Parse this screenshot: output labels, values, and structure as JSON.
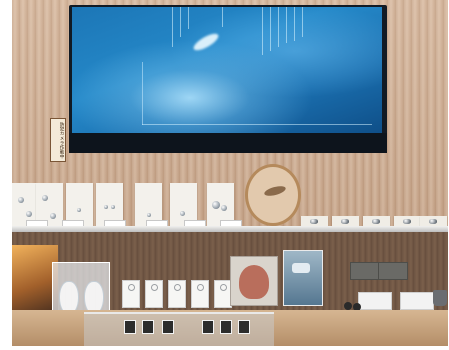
{
  "scene": {
    "description_tags": [
      "jewelry-shop-display",
      "wood-slat-wall",
      "wall-monitor"
    ],
    "monitor": {
      "state": "on"
    },
    "sign": {
      "text": "防犯カメラ作動中"
    }
  }
}
